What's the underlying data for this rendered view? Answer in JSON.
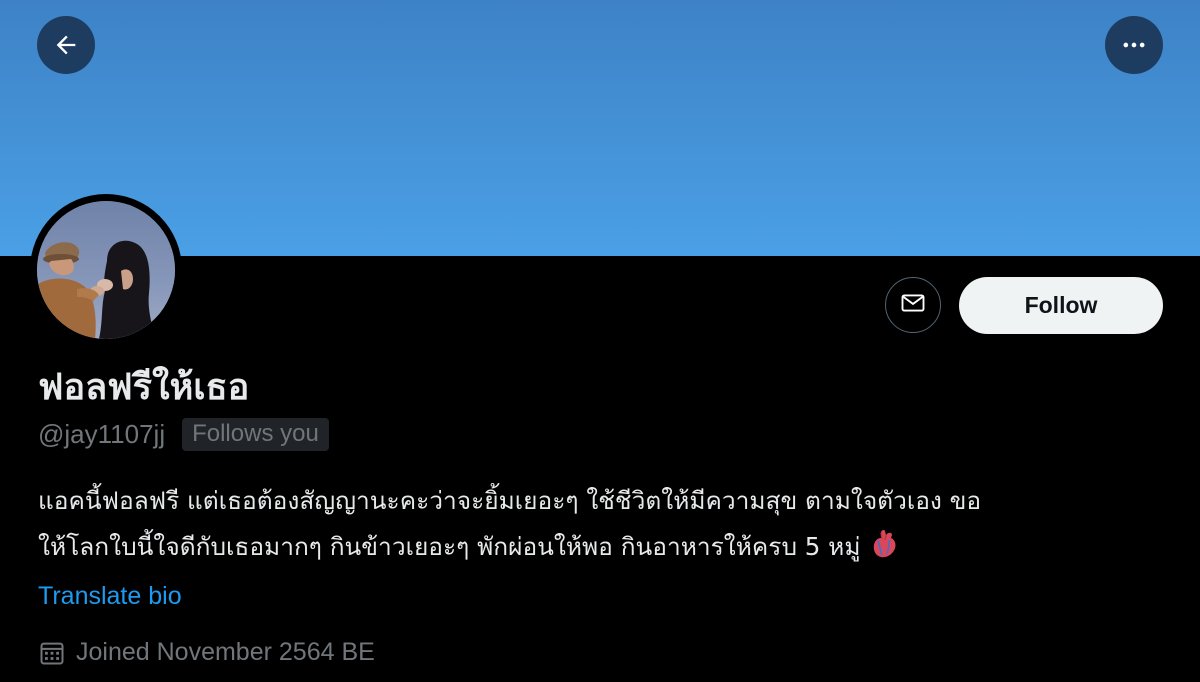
{
  "header": {
    "back_icon": "arrow-left-icon",
    "more_icon": "more-horizontal-icon"
  },
  "profile": {
    "display_name": "ฟอลฟรีให้เธอ",
    "handle": "@jay1107jj",
    "follows_you_badge": "Follows you",
    "bio_lines": [
      "แอคนี้ฟอลฟรี แต่เธอต้องสัญญานะคะว่าจะยิ้มเยอะๆ ใช้ชีวิตให้มีความสุข ตามใจตัวเอง ขอ",
      "ให้โลกใบนี้ใจดีกับเธอมากๆ กินข้าวเยอะๆ พักผ่อนให้พอ กินอาหารให้ครบ 5 หมู่"
    ],
    "bio_emoji": "anatomical-heart-emoji",
    "translate_link": "Translate bio",
    "joined_text": "Joined November 2564 BE",
    "joined_icon": "calendar-icon"
  },
  "actions": {
    "message_icon": "mail-icon",
    "follow_label": "Follow"
  },
  "colors": {
    "banner": "#4592d7",
    "background": "#000000",
    "primary_text": "#e7e9ea",
    "secondary_text": "#71767b",
    "link": "#1d9bf0",
    "follow_button_bg": "#eff3f4"
  }
}
